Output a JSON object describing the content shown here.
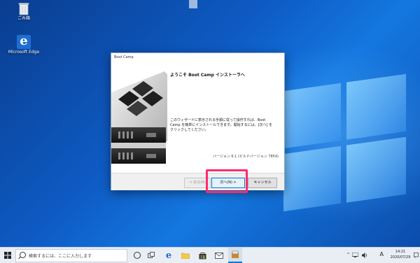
{
  "desktop": {
    "icons": [
      {
        "label": "ごみ箱",
        "icon": "recycle-bin-icon"
      },
      {
        "label": "Microsoft Edge",
        "icon": "edge-icon"
      }
    ]
  },
  "dialog": {
    "title": "Boot Camp",
    "heading": "ようこそ Boot Camp インストーラへ",
    "description": "このウィザードに表示される手順に従って操作すれば、Boot Camp を簡単にインストールできます。開始するには、[次へ] をクリックしてください。",
    "version": "バージョン 6.1 (ビルドバージョン 7854)",
    "buttons": {
      "back": "< 戻る(B)",
      "next": "次へ(N) >",
      "cancel": "キャンセル"
    }
  },
  "taskbar": {
    "search_placeholder": "検索するには、ここに入力します",
    "ime": "A",
    "time": "14:21",
    "date": "2020/07/29",
    "highlight_color": "#ff2a6e"
  }
}
